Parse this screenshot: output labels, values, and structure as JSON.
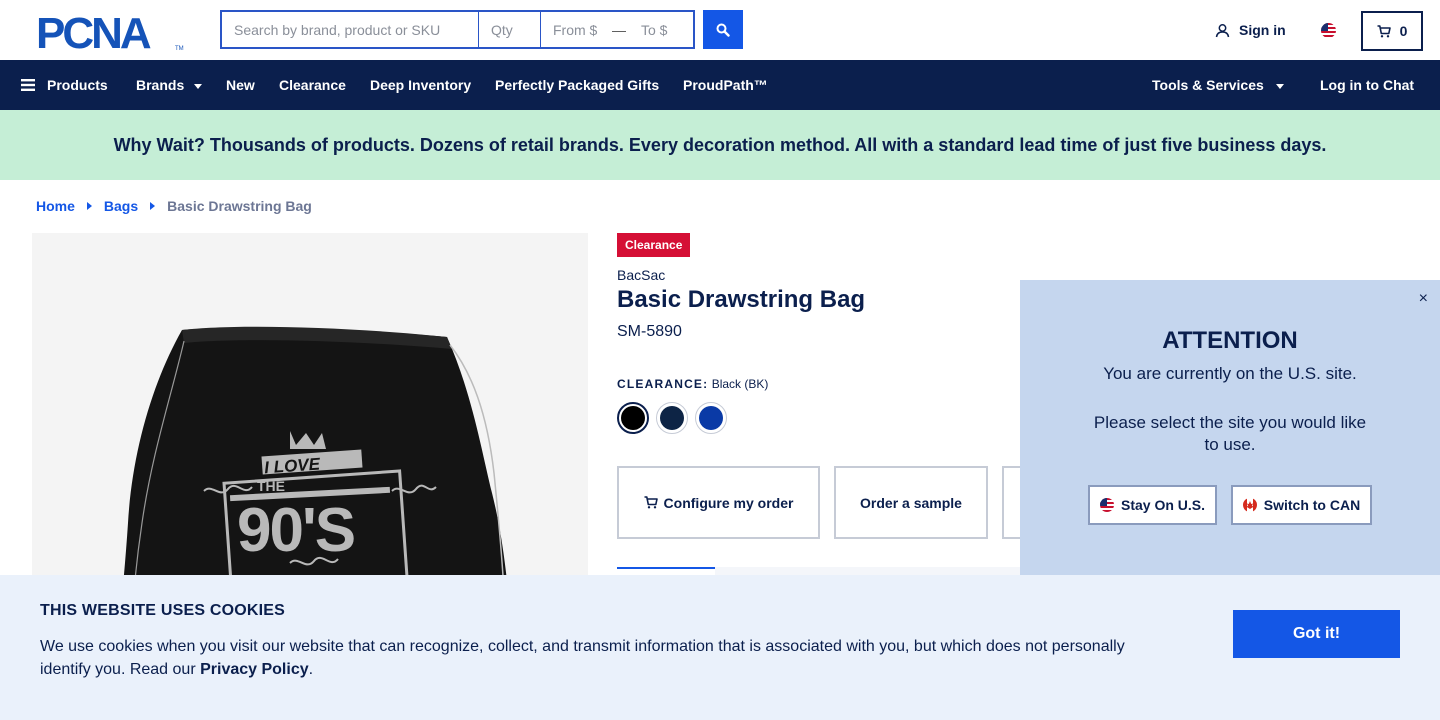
{
  "header": {
    "logo_text": "PCNA",
    "search": {
      "placeholder": "Search by brand, product or SKU",
      "value": ""
    },
    "qty": {
      "placeholder": "Qty"
    },
    "price_from": {
      "placeholder": "From $"
    },
    "price_to": {
      "placeholder": "To $"
    },
    "range_dash": "—",
    "signin_label": "Sign in",
    "cart_count": "0",
    "icons": [
      "search-icon",
      "user-icon",
      "us-flag-icon",
      "cart-icon"
    ]
  },
  "nav": {
    "products": "Products",
    "brands": "Brands",
    "new": "New",
    "clearance": "Clearance",
    "deep_inventory": "Deep Inventory",
    "gifts": "Perfectly Packaged Gifts",
    "proudpath": "ProudPath™",
    "tools": "Tools & Services",
    "chat": "Log in to Chat"
  },
  "promo": "Why Wait? Thousands of products. Dozens of retail brands. Every decoration method. All with a standard lead time of just five business days.",
  "breadcrumb": {
    "home": "Home",
    "category": "Bags",
    "current": "Basic Drawstring Bag"
  },
  "product": {
    "badge": "Clearance",
    "brand": "BacSac",
    "title": "Basic Drawstring Bag",
    "sku": "SM-5890",
    "color_label": "CLEARANCE:",
    "color_value": "Black (BK)",
    "swatches": [
      {
        "name": "Black",
        "hex": "#000000",
        "selected": true
      },
      {
        "name": "Navy",
        "hex": "#0d2445",
        "selected": false
      },
      {
        "name": "Royal Blue",
        "hex": "#0a3aa6",
        "selected": false
      }
    ],
    "image_text": {
      "line1": "I LOVE",
      "line2": "THE",
      "line3": "90'S"
    },
    "actions": {
      "configure": "Configure my order",
      "sample": "Order a sample"
    }
  },
  "modal": {
    "title": "ATTENTION",
    "line1": "You are currently on the U.S. site.",
    "line2": "Please select the site you would like to use.",
    "stay": "Stay On U.S.",
    "switch": "Switch to CAN",
    "close": "×"
  },
  "cookie": {
    "title": "THIS WEBSITE USES COOKIES",
    "text": "We use cookies when you visit our website that can recognize, collect, and transmit information that is associated with you, but which does not personally identify you. Read our ",
    "link": "Privacy Policy",
    "period": ".",
    "button": "Got it!"
  },
  "colors": {
    "navy": "#0b1f4d",
    "brand_blue": "#1457e6",
    "promo_green": "#c5eed6",
    "clearance_red": "#d50f35",
    "modal_blue": "#c5d6ee",
    "cookie_bg": "#eaf1fb"
  }
}
